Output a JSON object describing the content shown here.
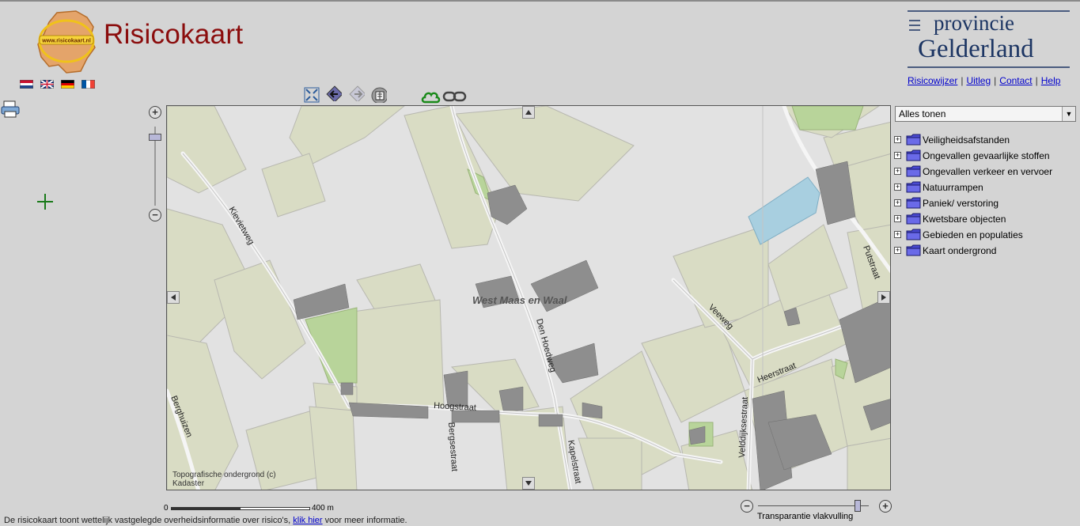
{
  "header": {
    "title": "Risicokaart",
    "logo_text": "www.risicokaart.nl",
    "province_line1": "provincie",
    "province_line2": "Gelderland"
  },
  "language_flags": [
    "nl-flag-icon",
    "uk-flag-icon",
    "de-flag-icon",
    "fr-flag-icon"
  ],
  "header_links": [
    {
      "label": "Risicowijzer"
    },
    {
      "label": "Uitleg"
    },
    {
      "label": "Contact"
    },
    {
      "label": "Help"
    }
  ],
  "toolbar": [
    "full-extent-icon",
    "back-icon",
    "forward-icon",
    "measure-icon",
    "cloud-icon",
    "link-icon"
  ],
  "map": {
    "municipality_label": "West Maas en Waal",
    "streets": [
      "Kievietweg",
      "Den Hoedweg",
      "Hoogstraat",
      "Bergsestraat",
      "Kapelstraat",
      "Veeweg",
      "Heerstraat",
      "Velddijksestraat",
      "Putstraat",
      "Berghuizen"
    ],
    "attribution_line1": "Topografische ondergrond (c)",
    "attribution_line2": "Kadaster"
  },
  "scalebar": {
    "start": "0",
    "end": "400 m"
  },
  "transparency": {
    "label": "Transparantie vlakvulling",
    "value_fraction": 0.9
  },
  "layer_select": {
    "value": "Alles tonen"
  },
  "layers": [
    {
      "label": "Veiligheidsafstanden"
    },
    {
      "label": "Ongevallen gevaarlijke stoffen"
    },
    {
      "label": "Ongevallen verkeer en vervoer"
    },
    {
      "label": "Natuurrampen"
    },
    {
      "label": "Paniek/ verstoring"
    },
    {
      "label": "Kwetsbare objecten"
    },
    {
      "label": "Gebieden en populaties"
    },
    {
      "label": "Kaart ondergrond"
    }
  ],
  "footer": {
    "text_before": "De risicokaart toont wettelijk vastgelegde overheidsinformatie over risico's,",
    "link": "klik hier",
    "text_after": "voor meer informatie."
  },
  "colors": {
    "title_red": "#8b0d0d",
    "province_blue": "#1c3563",
    "link_blue": "#0000cc",
    "field_green": "#d8dcc2",
    "building_grey": "#8e8e8e"
  }
}
